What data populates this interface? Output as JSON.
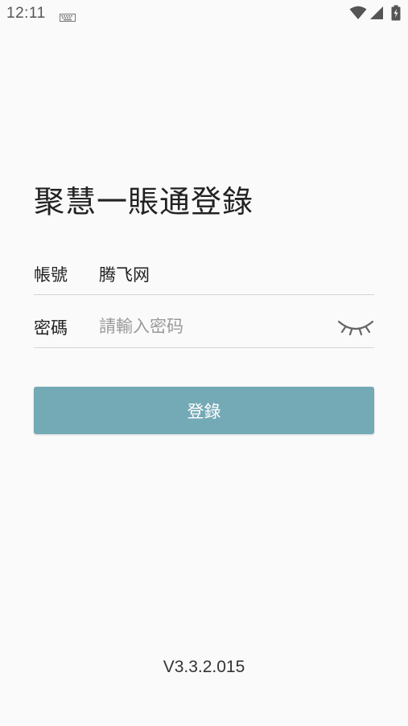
{
  "status_bar": {
    "time": "12:11",
    "icons": [
      "keyboard-icon",
      "wifi-icon",
      "signal-icon",
      "battery-charging-icon"
    ]
  },
  "login": {
    "title": "聚慧一賬通登錄",
    "account": {
      "label": "帳號",
      "value": "腾飞网"
    },
    "password": {
      "label": "密碼",
      "value": "",
      "placeholder": "請輸入密码",
      "visibility_icon": "eye-closed-icon"
    },
    "submit_label": "登錄"
  },
  "footer": {
    "version": "V3.3.2.015"
  },
  "colors": {
    "background": "#fafafa",
    "button": "#74a9b6",
    "button_text": "#ffffff",
    "divider": "#d4d4d4",
    "placeholder": "#9a9a9a"
  }
}
